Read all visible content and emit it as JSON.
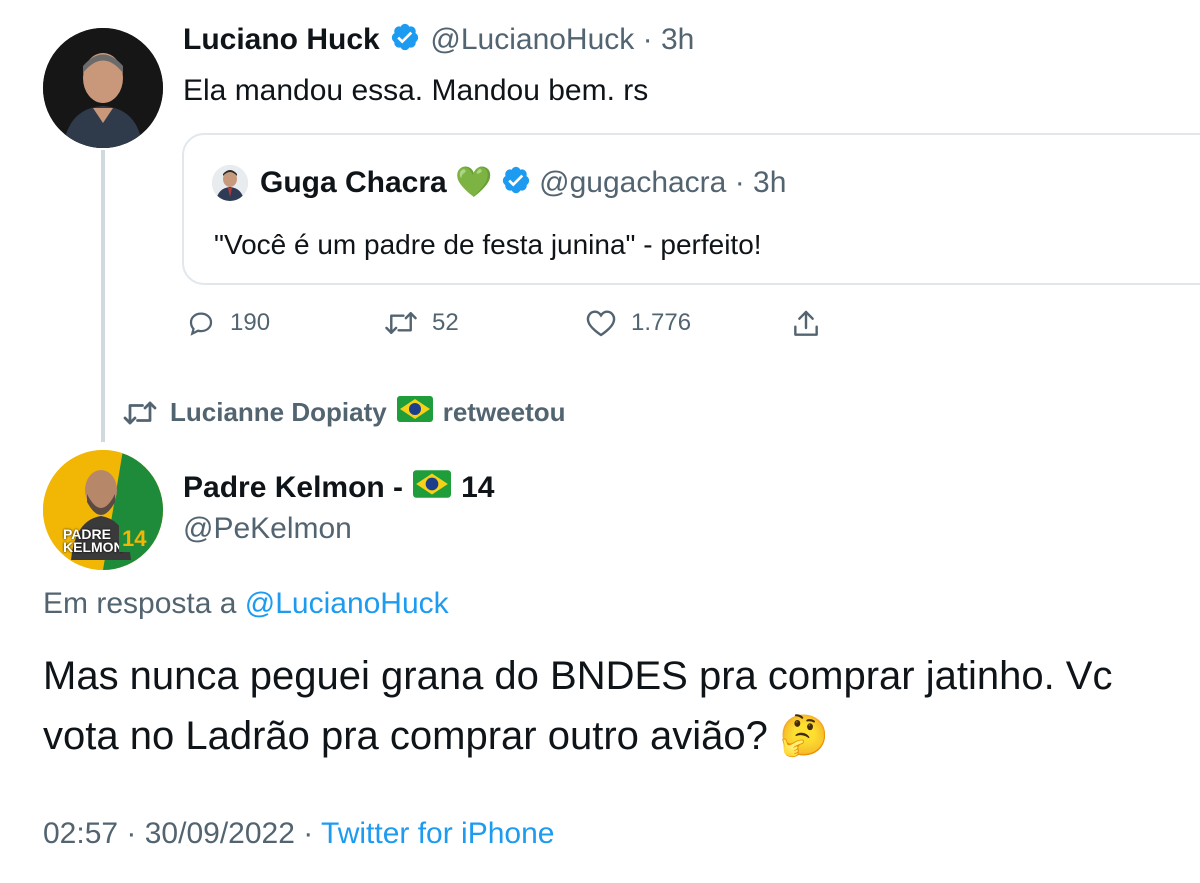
{
  "tweet1": {
    "name": "Luciano Huck",
    "handle": "@LucianoHuck",
    "time": "3h",
    "text": "Ela mandou essa. Mandou bem. rs",
    "quote": {
      "name": "Guga Chacra",
      "emoji": "💚",
      "handle": "@gugachacra",
      "time": "3h",
      "text": "\"Você é um padre de festa junina\" - perfeito!"
    },
    "actions": {
      "replies": "190",
      "retweets": "52",
      "likes": "1.776"
    }
  },
  "retweet_notice": {
    "user": "Lucianne Dopiaty",
    "suffix": "retweetou"
  },
  "tweet2": {
    "name": "Padre Kelmon -",
    "number": "14",
    "handle": "@PeKelmon",
    "avatar_text_top": "PADRE",
    "avatar_text_bottom": "KELMON",
    "avatar_number": "14",
    "reply_prefix": "Em resposta a",
    "reply_to": "@LucianoHuck",
    "text": "Mas nunca peguei grana do BNDES pra comprar jatinho. Vc vota no Ladrão pra comprar outro avião?",
    "emoji": "🤔",
    "time": "02:57",
    "date": "30/09/2022",
    "source": "Twitter for iPhone"
  },
  "colors": {
    "accent": "#1d9bf0",
    "muted": "#536471",
    "thread": "#cfd9de"
  }
}
